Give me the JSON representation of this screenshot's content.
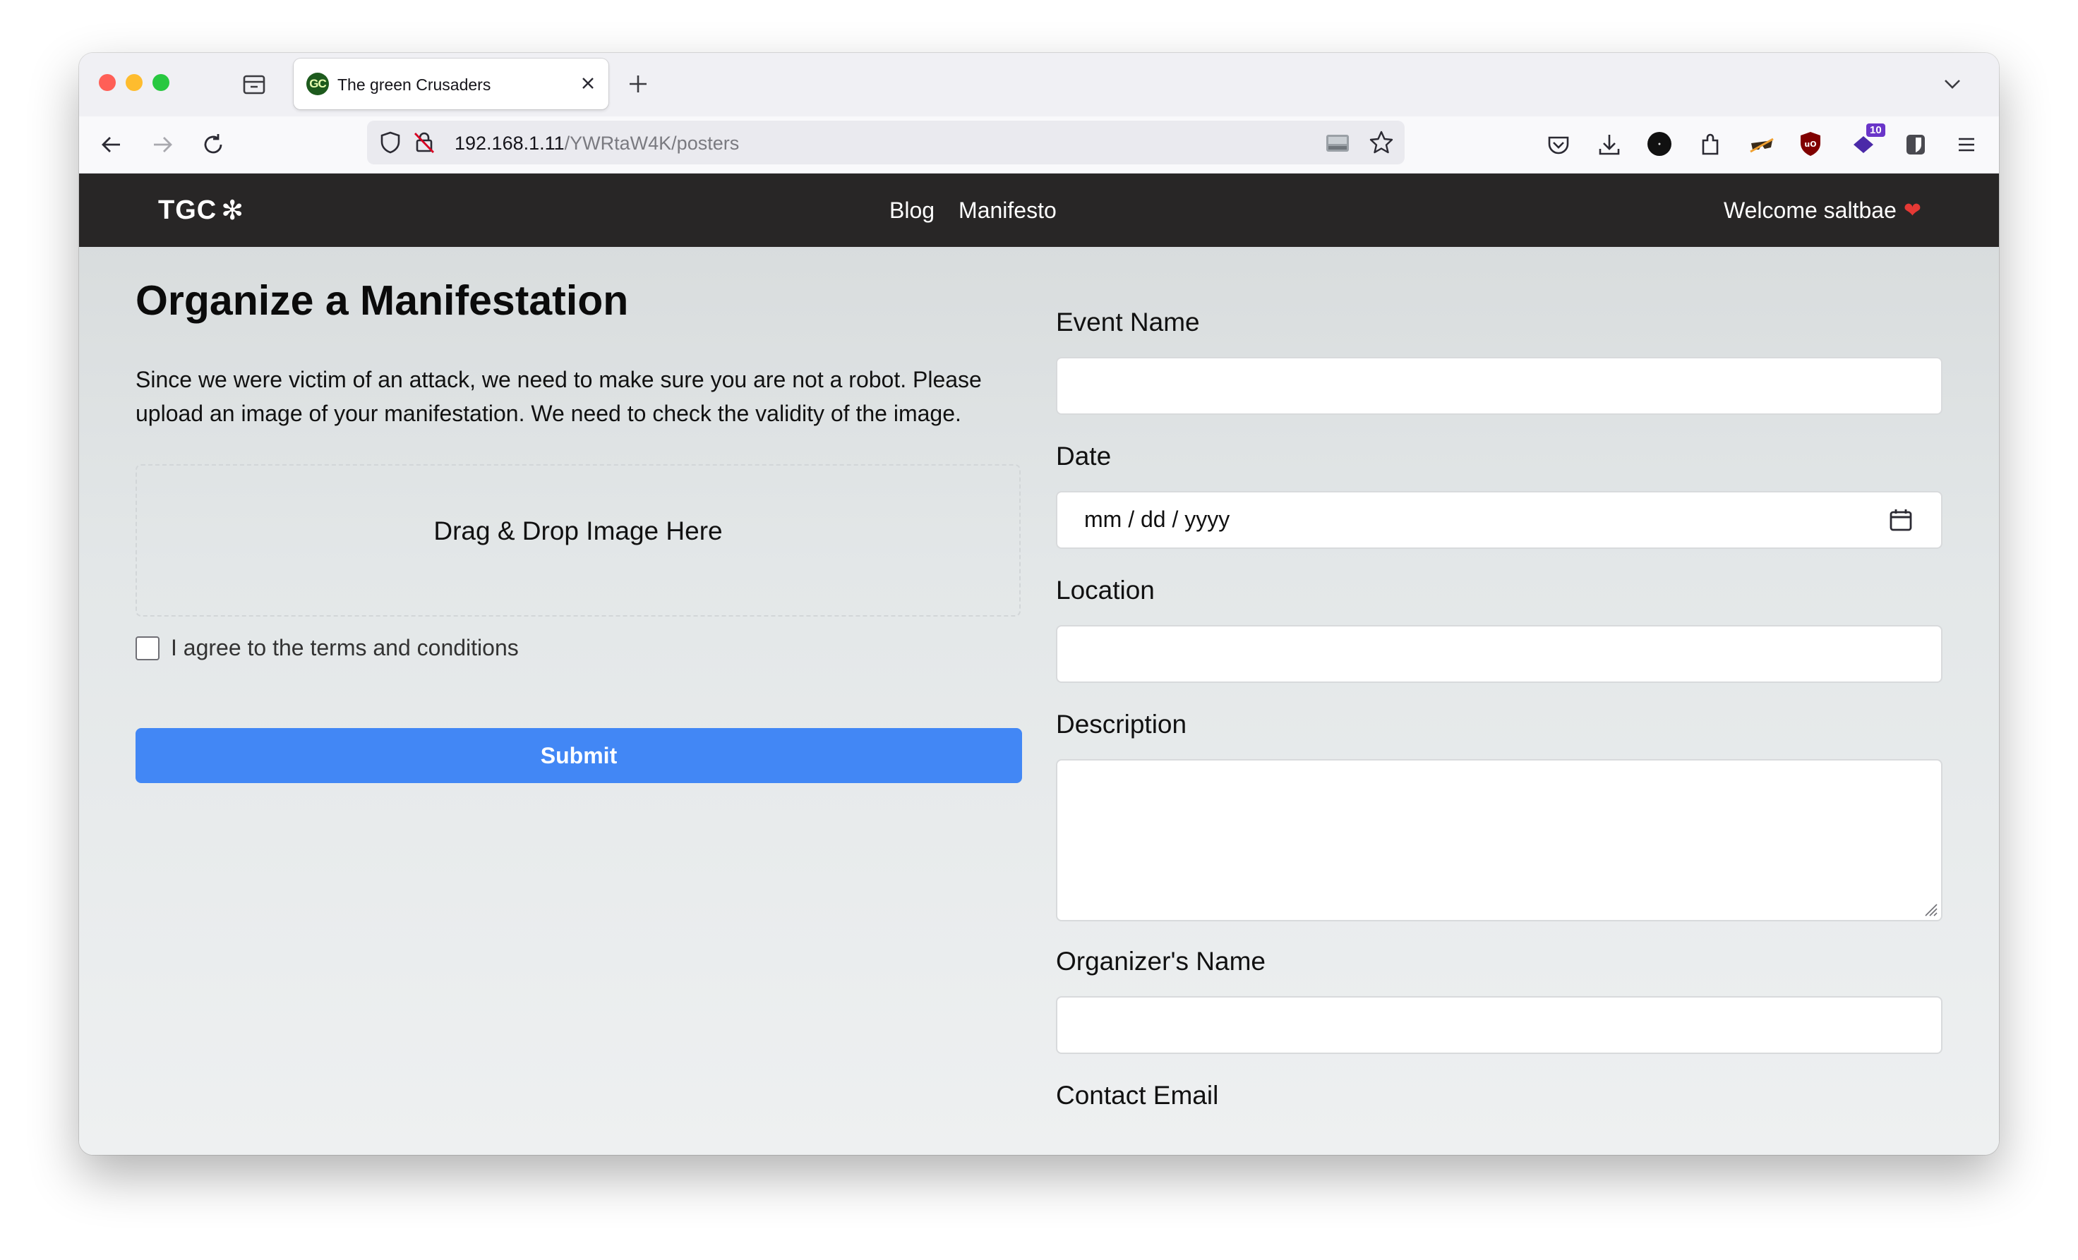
{
  "browser": {
    "tab": {
      "favicon_text": "GC",
      "title": "The green Crusaders"
    },
    "url": {
      "host": "192.168.1.11",
      "path": "/YWRtaW4K/posters"
    },
    "extension_badge": "10"
  },
  "site": {
    "brand": "TGC",
    "brand_mark": "✻",
    "nav": {
      "blog": "Blog",
      "manifesto": "Manifesto"
    },
    "welcome": "Welcome saltbae",
    "heart": "❤"
  },
  "main": {
    "title": "Organize a Manifestation",
    "intro": "Since we were victim of an attack, we need to make sure you are not a robot. Please upload an image of your manifestation. We need to check the validity of the image.",
    "dropzone_label": "Drag & Drop Image Here",
    "agree_label": "I agree to the terms and conditions",
    "submit_label": "Submit"
  },
  "form": {
    "event_name_label": "Event Name",
    "date_label": "Date",
    "date_placeholder": "mm / dd / yyyy",
    "location_label": "Location",
    "description_label": "Description",
    "organizer_label": "Organizer's Name",
    "contact_label": "Contact Email"
  },
  "colors": {
    "navbar": "#282626",
    "submit": "#4287f5",
    "heart": "#e53935"
  }
}
